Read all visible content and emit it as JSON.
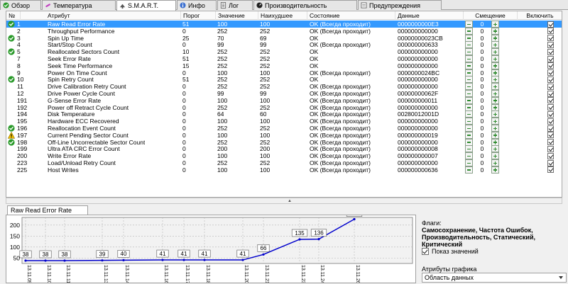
{
  "tabs": [
    {
      "label": "Обзор",
      "icon": "check-icon"
    },
    {
      "label": "Температура",
      "icon": "thermometer-icon"
    },
    {
      "label": "S.M.A.R.T.",
      "icon": "smart-icon",
      "active": true
    },
    {
      "label": "Инфо",
      "icon": "info-icon"
    },
    {
      "label": "Лог",
      "icon": "log-icon"
    },
    {
      "label": "Производительность",
      "icon": "gauge-icon"
    },
    {
      "label": "Предупреждения",
      "icon": "warning-icon"
    }
  ],
  "columns": [
    "№",
    "Атрибут",
    "Порог",
    "Значение",
    "Наихудшее",
    "Состояние",
    "Данные",
    "Смещение",
    "Включить"
  ],
  "rows": [
    {
      "n": "1",
      "attr": "Raw Read Error Rate",
      "thr": "51",
      "val": "100",
      "worst": "100",
      "state": "OK (Всегда проходит)",
      "data": "0000000000E3",
      "offset": "0",
      "status": "ok",
      "selected": true
    },
    {
      "n": "2",
      "attr": "Throughput Performance",
      "thr": "0",
      "val": "252",
      "worst": "252",
      "state": "OK (Всегда проходит)",
      "data": "000000000000",
      "offset": "0",
      "status": ""
    },
    {
      "n": "3",
      "attr": "Spin Up Time",
      "thr": "25",
      "val": "70",
      "worst": "69",
      "state": "OK",
      "data": "00000000023CB",
      "offset": "0",
      "status": "ok"
    },
    {
      "n": "4",
      "attr": "Start/Stop Count",
      "thr": "0",
      "val": "99",
      "worst": "99",
      "state": "OK (Всегда проходит)",
      "data": "000000000633",
      "offset": "0",
      "status": ""
    },
    {
      "n": "5",
      "attr": "Reallocated Sectors Count",
      "thr": "10",
      "val": "252",
      "worst": "252",
      "state": "OK",
      "data": "000000000000",
      "offset": "0",
      "status": "ok"
    },
    {
      "n": "7",
      "attr": "Seek Error Rate",
      "thr": "51",
      "val": "252",
      "worst": "252",
      "state": "OK",
      "data": "000000000000",
      "offset": "0",
      "status": ""
    },
    {
      "n": "8",
      "attr": "Seek Time Performance",
      "thr": "15",
      "val": "252",
      "worst": "252",
      "state": "OK",
      "data": "000000000000",
      "offset": "0",
      "status": ""
    },
    {
      "n": "9",
      "attr": "Power On Time Count",
      "thr": "0",
      "val": "100",
      "worst": "100",
      "state": "OK (Всегда проходит)",
      "data": "0000000024BC",
      "offset": "0",
      "status": ""
    },
    {
      "n": "10",
      "attr": "Spin Retry Count",
      "thr": "51",
      "val": "252",
      "worst": "252",
      "state": "OK",
      "data": "000000000000",
      "offset": "0",
      "status": "ok"
    },
    {
      "n": "11",
      "attr": "Drive Calibration Retry Count",
      "thr": "0",
      "val": "252",
      "worst": "252",
      "state": "OK (Всегда проходит)",
      "data": "000000000000",
      "offset": "0",
      "status": ""
    },
    {
      "n": "12",
      "attr": "Drive Power Cycle Count",
      "thr": "0",
      "val": "99",
      "worst": "99",
      "state": "OK (Всегда проходит)",
      "data": "00000000062F",
      "offset": "0",
      "status": ""
    },
    {
      "n": "191",
      "attr": "G-Sense Error Rate",
      "thr": "0",
      "val": "100",
      "worst": "100",
      "state": "OK (Всегда проходит)",
      "data": "000000000011",
      "offset": "0",
      "status": ""
    },
    {
      "n": "192",
      "attr": "Power off Retract Cycle Count",
      "thr": "0",
      "val": "252",
      "worst": "252",
      "state": "OK (Всегда проходит)",
      "data": "000000000000",
      "offset": "0",
      "status": ""
    },
    {
      "n": "194",
      "attr": "Disk Temperature",
      "thr": "0",
      "val": "64",
      "worst": "60",
      "state": "OK (Всегда проходит)",
      "data": "00280012001D",
      "offset": "0",
      "status": ""
    },
    {
      "n": "195",
      "attr": "Hardware ECC Recovered",
      "thr": "0",
      "val": "100",
      "worst": "100",
      "state": "OK (Всегда проходит)",
      "data": "000000000000",
      "offset": "0",
      "status": ""
    },
    {
      "n": "196",
      "attr": "Reallocation Event Count",
      "thr": "0",
      "val": "252",
      "worst": "252",
      "state": "OK (Всегда проходит)",
      "data": "000000000000",
      "offset": "0",
      "status": "ok"
    },
    {
      "n": "197",
      "attr": "Current Pending Sector Count",
      "thr": "0",
      "val": "100",
      "worst": "100",
      "state": "OK (Всегда проходит)",
      "data": "000000000019",
      "offset": "0",
      "status": "warn"
    },
    {
      "n": "198",
      "attr": "Off-Line Uncorrectable Sector Count",
      "thr": "0",
      "val": "252",
      "worst": "252",
      "state": "OK (Всегда проходит)",
      "data": "000000000000",
      "offset": "0",
      "status": "ok"
    },
    {
      "n": "199",
      "attr": "Ultra ATA CRC Error Count",
      "thr": "0",
      "val": "200",
      "worst": "200",
      "state": "OK (Всегда проходит)",
      "data": "000000000008",
      "offset": "0",
      "status": ""
    },
    {
      "n": "200",
      "attr": "Write Error Rate",
      "thr": "0",
      "val": "100",
      "worst": "100",
      "state": "OK (Всегда проходит)",
      "data": "000000000007",
      "offset": "0",
      "status": ""
    },
    {
      "n": "223",
      "attr": "Load/Unload Retry Count",
      "thr": "0",
      "val": "252",
      "worst": "252",
      "state": "OK (Всегда проходит)",
      "data": "000000000000",
      "offset": "0",
      "status": ""
    },
    {
      "n": "225",
      "attr": "Host Writes",
      "thr": "0",
      "val": "100",
      "worst": "100",
      "state": "OK (Всегда проходит)",
      "data": "000000000636",
      "offset": "0",
      "status": ""
    }
  ],
  "bottom_tab": "Raw Read Error Rate",
  "flags_label": "Флаги:",
  "flags_value": "Самосохранение, Частота Ошибок, Производительность, Статический, Критический",
  "show_values_label": "Показ значений",
  "graph_attrs_label": "Атрибуты графика",
  "graph_attrs_value": "Область данных",
  "chart_data": {
    "type": "line",
    "x": [
      "13.11.09",
      "13.11.10",
      "13.11.11",
      "13.11.13",
      "13.11.14",
      "13.11.16",
      "13.11.17",
      "13.11.18",
      "13.11.20",
      "13.11.21",
      "13.11.23",
      "13.11.24",
      "13.11.26"
    ],
    "values": [
      38,
      38,
      38,
      39,
      40,
      41,
      41,
      41,
      41,
      66,
      135,
      136,
      227
    ],
    "yticks": [
      50,
      100,
      150,
      200
    ],
    "ylim": [
      25,
      235
    ],
    "grid": true,
    "color": "#0000cc"
  }
}
